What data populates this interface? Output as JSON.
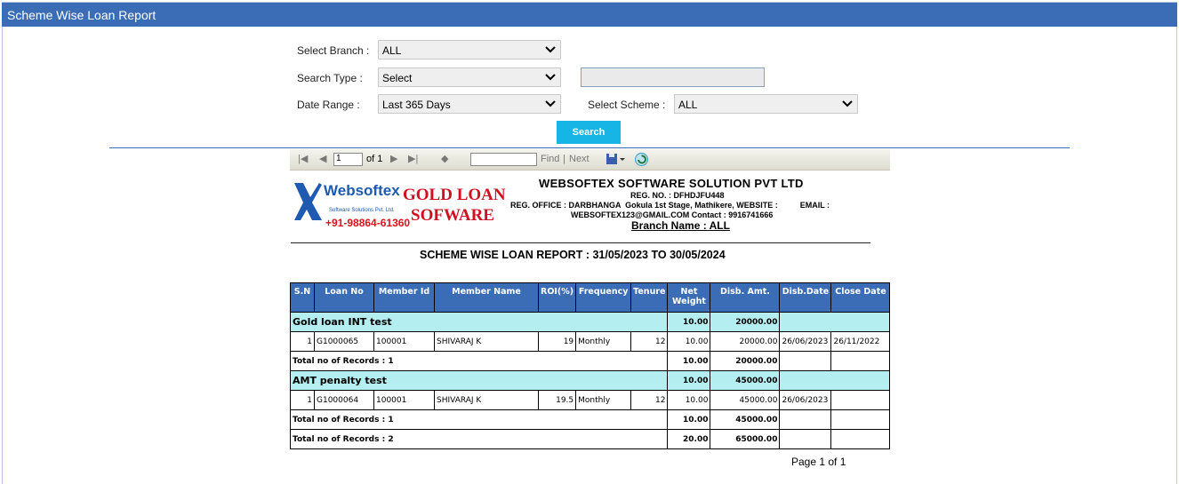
{
  "window": {
    "title": "Scheme Wise Loan Report"
  },
  "filters": {
    "branch_label": "Select Branch :",
    "branch_value": "ALL",
    "search_type_label": "Search Type :",
    "search_type_value": "Select",
    "date_range_label": "Date Range :",
    "date_range_value": "Last 365 Days",
    "scheme_label": "Select Scheme :",
    "scheme_value": "ALL",
    "search_button": "Search"
  },
  "viewer": {
    "page_input": "1",
    "of_pages": "of 1",
    "find": "Find",
    "sep": "|",
    "next": "Next"
  },
  "report": {
    "logo_word": "Websoftex",
    "logo_tag": "Software Solutions Pvt. Ltd.",
    "logo_phone": "+91-98864-61360",
    "gold_line1": "GOLD LOAN",
    "gold_line2": "SOFWARE",
    "company": "WEBSOFTEX SOFTWARE SOLUTION PVT LTD",
    "reg_no": "REG. NO. : DFHDJFU448",
    "reg_office": "REG. OFFICE : DARBHANGA  Gokula 1st Stage, Mathikere, WEBSITE :          EMAIL :",
    "contact": "WEBSOFTEX123@GMAIL.COM  Contact : 9916741666",
    "branch_name": "Branch Name : ALL",
    "title": "SCHEME WISE LOAN REPORT : 31/05/2023 TO 30/05/2024",
    "columns": [
      "S.N",
      "Loan No",
      "Member Id",
      "Member Name",
      "ROI(%)",
      "Frequency",
      "Tenure",
      "Net Weight",
      "Disb. Amt.",
      "Disb.Date",
      "Close Date"
    ],
    "groups": [
      {
        "name": "Gold loan INT test",
        "net_weight": "10.00",
        "disb_amt": "20000.00",
        "row": {
          "sn": "1",
          "loan_no": "G1000065",
          "member_id": "100001",
          "member_name": "SHIVARAJ K",
          "roi": "19",
          "frequency": "Monthly",
          "tenure": "12",
          "net_weight": "10.00",
          "disb_amt": "20000.00",
          "disb_date": "26/06/2023",
          "close_date": "26/11/2022"
        },
        "total_label": "Total no of Records : 1",
        "total_weight": "10.00",
        "total_amt": "20000.00"
      },
      {
        "name": "AMT penalty test",
        "net_weight": "10.00",
        "disb_amt": "45000.00",
        "row": {
          "sn": "1",
          "loan_no": "G1000064",
          "member_id": "100001",
          "member_name": "SHIVARAJ K",
          "roi": "19.5",
          "frequency": "Monthly",
          "tenure": "12",
          "net_weight": "10.00",
          "disb_amt": "45000.00",
          "disb_date": "26/06/2023",
          "close_date": ""
        },
        "total_label": "Total no of Records : 1",
        "total_weight": "10.00",
        "total_amt": "45000.00"
      }
    ],
    "grand_label": "Total no of Records : 2",
    "grand_weight": "20.00",
    "grand_amt": "65000.00",
    "page_footer": "Page 1 of 1"
  },
  "colors": {
    "header": "#3a6db5",
    "group_row": "#b4eef0",
    "button": "#17b5e6"
  }
}
